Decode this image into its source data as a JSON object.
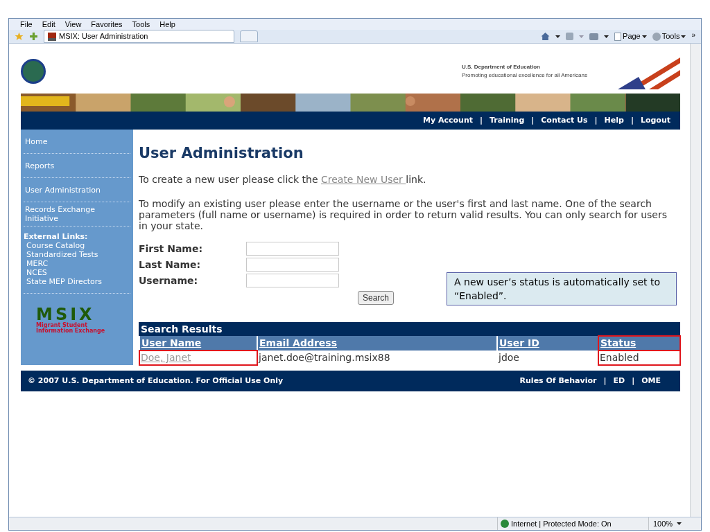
{
  "browser": {
    "menu": [
      "File",
      "Edit",
      "View",
      "Favorites",
      "Tools",
      "Help"
    ],
    "tab": {
      "title": "MSIX: User Administration"
    },
    "toolbar": [
      {
        "label": "Page"
      },
      {
        "label": "Tools"
      }
    ],
    "more": "»"
  },
  "header": {
    "org": "U.S. Department of Education",
    "tagline": "Promoting educational excellence for all Americans"
  },
  "nav": {
    "separator": "|",
    "items": [
      "My Account",
      "Training",
      "Contact Us",
      "Help",
      "Logout"
    ]
  },
  "sidebar": {
    "items": [
      "Home",
      "Reports",
      "User Administration",
      "Records Exchange Initiative"
    ],
    "external": {
      "heading": "External Links:",
      "items": [
        "Course Catalog",
        "Standardized Tests",
        "MERC",
        "NCES",
        "State MEP Directors"
      ]
    },
    "logo": {
      "mark": "MSIX",
      "line1": "Migrant Student",
      "line2": "Information Exchange"
    }
  },
  "main": {
    "title": "User Administration",
    "intro": {
      "before": "To create a new user please click the ",
      "link": "Create New User ",
      "after": "link."
    },
    "description": "To modify an existing user please enter the username or the user's first and last name. One of the search parameters (full name or username) is required in order to return valid results. You can only search for users in your state.",
    "fields": [
      {
        "label": "First Name:"
      },
      {
        "label": "Last Name:"
      },
      {
        "label": "Username:"
      }
    ],
    "search_button": "Search",
    "callout": "A new user’s status is automatically set to “Enabled”.",
    "results": {
      "title": "Search Results",
      "columns": [
        {
          "label": "User Name",
          "highlighted": false
        },
        {
          "label": "Email Address",
          "highlighted": false
        },
        {
          "label": "User ID",
          "highlighted": false
        },
        {
          "label": "Status",
          "highlighted": true
        }
      ],
      "rows": [
        {
          "cells": [
            {
              "text": "Doe, Janet",
              "kind": "link",
              "highlighted": true
            },
            {
              "text": "janet.doe@training.msix88",
              "kind": "text",
              "highlighted": false
            },
            {
              "text": "jdoe",
              "kind": "text",
              "highlighted": false
            },
            {
              "text": "Enabled",
              "kind": "text",
              "highlighted": true
            }
          ]
        }
      ]
    }
  },
  "footer": {
    "copyright": "© 2007 U.S. Department of Education. For Official Use Only",
    "separator": "|",
    "links": [
      "Rules Of Behavior",
      "ED",
      "OME"
    ]
  },
  "status_bar": {
    "zone": "Internet | Protected Mode: On",
    "zoom": "100%"
  }
}
